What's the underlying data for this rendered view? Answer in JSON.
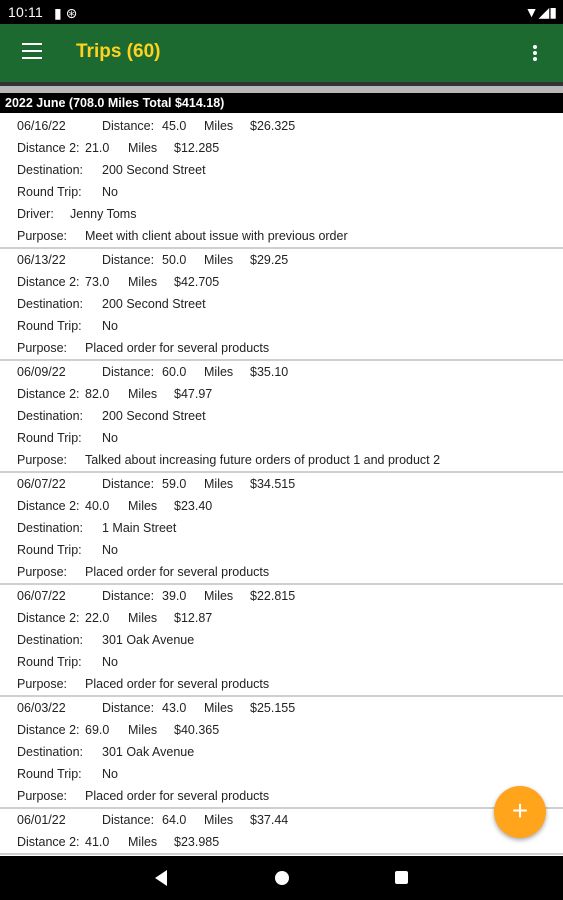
{
  "status_bar": {
    "time": "10:11",
    "left_icons": "▮ ⊛",
    "right_icons": "▼◢▮"
  },
  "app_bar": {
    "title": "Trips (60)",
    "menu_icon": "hamburger-menu-icon",
    "overflow_icon": "more-vert-icon",
    "background": "#1d6a31",
    "title_color": "#ffd21f"
  },
  "section_header": "2022 June (708.0 Miles Total $414.18)",
  "labels": {
    "distance": "Distance:",
    "distance2": "Distance 2:",
    "miles": "Miles",
    "destination": "Destination:",
    "round_trip": "Round Trip:",
    "driver": "Driver:",
    "purpose": "Purpose:"
  },
  "trips": [
    {
      "date": "06/16/22",
      "distance": "45.0",
      "amount": "$26.325",
      "distance2": "21.0",
      "amount2": "$12.285",
      "destination": "200 Second Street",
      "round_trip": "No",
      "driver": "Jenny Toms",
      "purpose": "Meet with client about issue with previous order"
    },
    {
      "date": "06/13/22",
      "distance": "50.0",
      "amount": "$29.25",
      "distance2": "73.0",
      "amount2": "$42.705",
      "destination": "200 Second Street",
      "round_trip": "No",
      "purpose": "Placed order for several products"
    },
    {
      "date": "06/09/22",
      "distance": "60.0",
      "amount": "$35.10",
      "distance2": "82.0",
      "amount2": "$47.97",
      "destination": "200 Second Street",
      "round_trip": "No",
      "purpose": "Talked about increasing future orders of product 1 and product 2"
    },
    {
      "date": "06/07/22",
      "distance": "59.0",
      "amount": "$34.515",
      "distance2": "40.0",
      "amount2": "$23.40",
      "destination": "1 Main Street",
      "round_trip": "No",
      "purpose": "Placed order for several products"
    },
    {
      "date": "06/07/22",
      "distance": "39.0",
      "amount": "$22.815",
      "distance2": "22.0",
      "amount2": "$12.87",
      "destination": "301 Oak Avenue",
      "round_trip": "No",
      "purpose": "Placed order for several products"
    },
    {
      "date": "06/03/22",
      "distance": "43.0",
      "amount": "$25.155",
      "distance2": "69.0",
      "amount2": "$40.365",
      "destination": "301 Oak Avenue",
      "round_trip": "No",
      "purpose": "Placed order for several products"
    },
    {
      "date": "06/01/22",
      "distance": "64.0",
      "amount": "$37.44",
      "distance2": "41.0",
      "amount2": "$23.985"
    }
  ],
  "fab": {
    "label": "+",
    "icon": "add-icon",
    "color": "#ffa41b"
  },
  "nav_bar": {
    "back_icon": "back-triangle-icon",
    "home_icon": "home-circle-icon",
    "recents_icon": "recents-square-icon"
  }
}
